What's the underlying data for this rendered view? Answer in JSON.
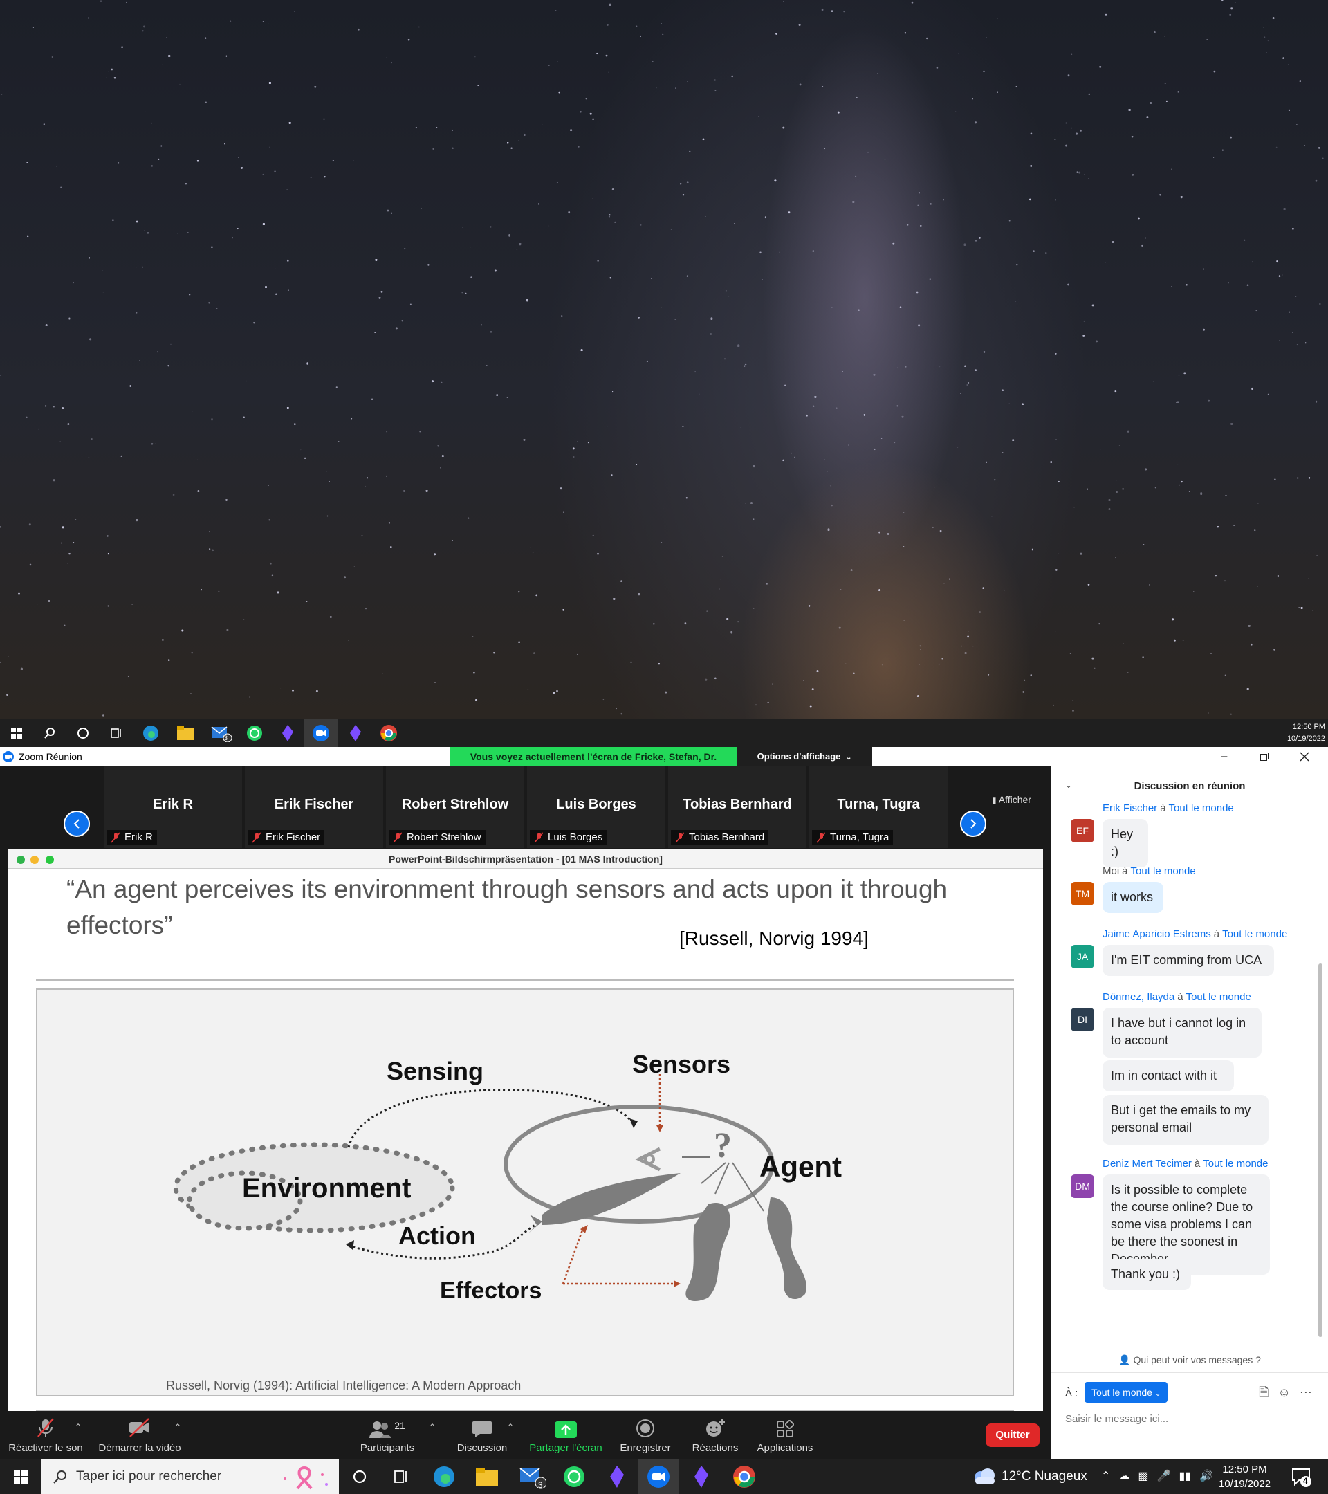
{
  "desktop_top": {
    "taskbar": {
      "icons": [
        "windows-icon",
        "search-icon",
        "cortana-icon",
        "task-view-icon",
        "edge-icon",
        "file-explorer-icon",
        "mail-icon",
        "whatsapp-icon",
        "obsidian-icon",
        "zoom-icon",
        "obsidian-icon",
        "chrome-icon"
      ],
      "mail_badge": "3",
      "time": "12:50 PM",
      "date": "10/19/2022"
    }
  },
  "window": {
    "title": "Zoom Réunion",
    "share_banner": "Vous voyez actuellement l'écran de Fricke, Stefan, Dr.",
    "view_options": "Options d'affichage",
    "controls": [
      "minimize-icon",
      "restore-icon",
      "close-icon"
    ]
  },
  "gallery": {
    "participants": [
      {
        "name": "Erik R",
        "label": "Erik R"
      },
      {
        "name": "Erik Fischer",
        "label": "Erik Fischer"
      },
      {
        "name": "Robert Strehlow",
        "label": "Robert Strehlow"
      },
      {
        "name": "Luis Borges",
        "label": "Luis Borges"
      },
      {
        "name": "Tobias Bernhard",
        "label": "Tobias Bernhard"
      },
      {
        "name": "Turna, Tugra",
        "label": "Turna, Tugra"
      }
    ],
    "show_label": "Afficher"
  },
  "shared_screen": {
    "window_title": "PowerPoint-Bildschirmpräsentation - [01 MAS Introduction]",
    "quote": "“An agent perceives its environment through sensors and acts upon it through effectors”",
    "citation": "[Russell, Norvig 1994]",
    "diagram_labels": {
      "sensing": "Sensing",
      "sensors": "Sensors",
      "environment": "Environment",
      "agent": "Agent",
      "action": "Action",
      "effectors": "Effectors"
    },
    "caption": "Russell, Norvig (1994): Artificial Intelligence: A Modern Approach"
  },
  "toolbar": {
    "unmute": "Réactiver le son",
    "start_video": "Démarrer la vidéo",
    "participants": "Participants",
    "participants_count": "21",
    "chat": "Discussion",
    "share_screen": "Partager l'écran",
    "record": "Enregistrer",
    "reactions": "Réactions",
    "apps": "Applications",
    "quit": "Quitter"
  },
  "chat": {
    "title": "Discussion en réunion",
    "to_word": "à",
    "groups": [
      {
        "from": "Erik Fischer",
        "to": "Tout le monde",
        "initials": "EF",
        "color": "#c0392b",
        "messages": [
          "Hey :)"
        ],
        "me": false
      },
      {
        "from": "Moi",
        "to": "Tout le monde",
        "initials": "TM",
        "color": "#d35400",
        "messages": [
          "it works"
        ],
        "me": true
      },
      {
        "from": "Jaime Aparicio Estrems",
        "to": "Tout le monde",
        "initials": "JA",
        "color": "#16a085",
        "messages": [
          "I'm EIT comming from UCA"
        ],
        "me": false
      },
      {
        "from": "Dönmez, Ilayda",
        "to": "Tout le monde",
        "initials": "DI",
        "color": "#2c3e50",
        "messages": [
          "I have but i cannot log in to account",
          "Im in contact with it",
          "But i get the emails to my personal email"
        ],
        "me": false
      },
      {
        "from": "Deniz Mert Tecimer",
        "to": "Tout le monde",
        "initials": "DM",
        "color": "#8e44ad",
        "messages": [
          "Is it possible to complete the course online? Due to some visa problems I can be there the soonest in December",
          "Thank you :)"
        ],
        "me": false
      }
    ],
    "who_can_see": "Qui peut voir vos messages ?",
    "to_label": "À :",
    "recipient": "Tout le monde",
    "input_placeholder": "Saisir le message ici..."
  },
  "taskbar_bottom": {
    "search_placeholder": "Taper ici pour rechercher",
    "mail_badge": "3",
    "weather": "12°C  Nuageux",
    "time": "12:50 PM",
    "date": "10/19/2022",
    "notifications": "4"
  }
}
